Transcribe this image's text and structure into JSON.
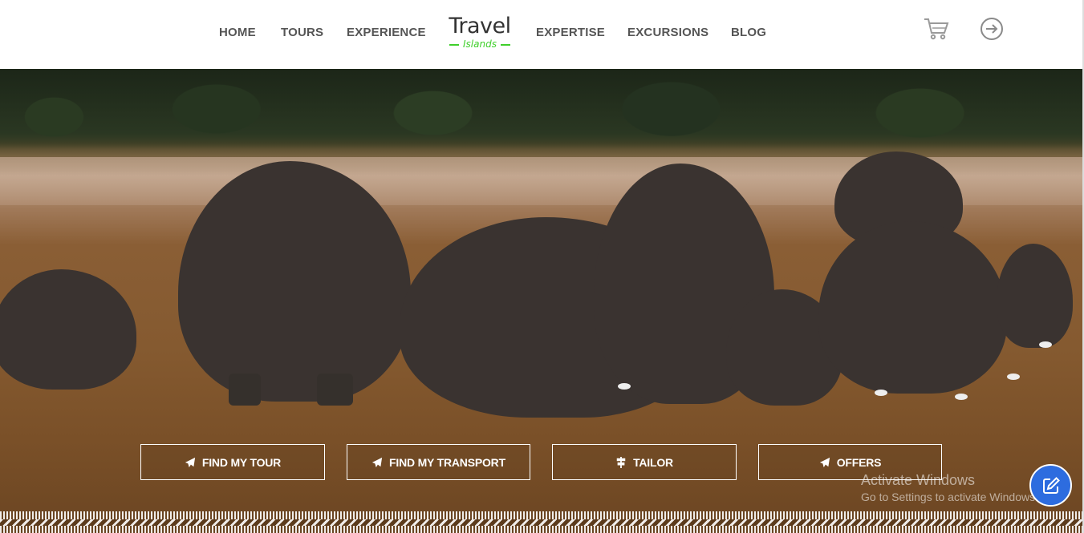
{
  "nav": {
    "items": [
      {
        "label": "HOME"
      },
      {
        "label": "TOURS"
      },
      {
        "label": "EXPERIENCE"
      },
      {
        "label": "EXPERTISE"
      },
      {
        "label": "EXCURSIONS"
      },
      {
        "label": "BLOG"
      }
    ],
    "logo": {
      "main": "Travel",
      "sub": "Islands"
    },
    "icons": {
      "cart": "cart-icon",
      "login": "login-arrow-icon"
    }
  },
  "hero": {
    "buttons": [
      {
        "label": "FIND MY TOUR",
        "icon": "paper-plane-icon"
      },
      {
        "label": "FIND MY TRANSPORT",
        "icon": "paper-plane-icon"
      },
      {
        "label": "TAILOR",
        "icon": "signpost-icon"
      },
      {
        "label": "OFFERS",
        "icon": "paper-plane-icon"
      }
    ]
  },
  "watermark": {
    "title": "Activate Windows",
    "subtitle": "Go to Settings to activate Windows."
  },
  "fab": {
    "icon": "edit-icon"
  },
  "colors": {
    "logo_accent": "#3fcf2b",
    "fab": "#2d6cdf",
    "nav_text": "#555555"
  }
}
